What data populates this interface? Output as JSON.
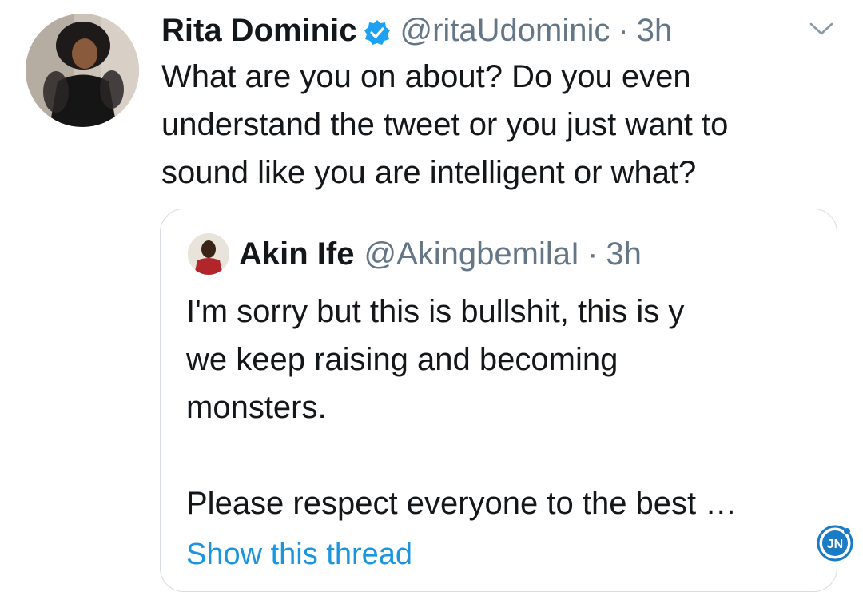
{
  "tweet": {
    "author_name": "Rita Dominic",
    "author_handle": "@ritaUdominic",
    "separator": "·",
    "time": "3h",
    "text_lines": [
      "What are you on about? Do you even",
      "understand the tweet or you just want to",
      "sound like you are intelligent or what?"
    ],
    "icons": {
      "verified": "verified-badge-icon",
      "menu": "chevron-down-icon"
    }
  },
  "quoted_tweet": {
    "author_name": "Akin Ife",
    "author_handle": "@AkingbemilaI",
    "separator": "·",
    "time": "3h",
    "text_lines": [
      "I'm sorry but this is bullshit, this is y",
      "we keep raising and becoming",
      "monsters.",
      "",
      "Please respect everyone to the best …"
    ],
    "show_thread_label": "Show this thread"
  },
  "watermark": {
    "text": "JN"
  },
  "colors": {
    "link": "#1b95e0",
    "secondary_text": "#657786",
    "border": "#d7dce0",
    "verified": "#1da1f2"
  }
}
